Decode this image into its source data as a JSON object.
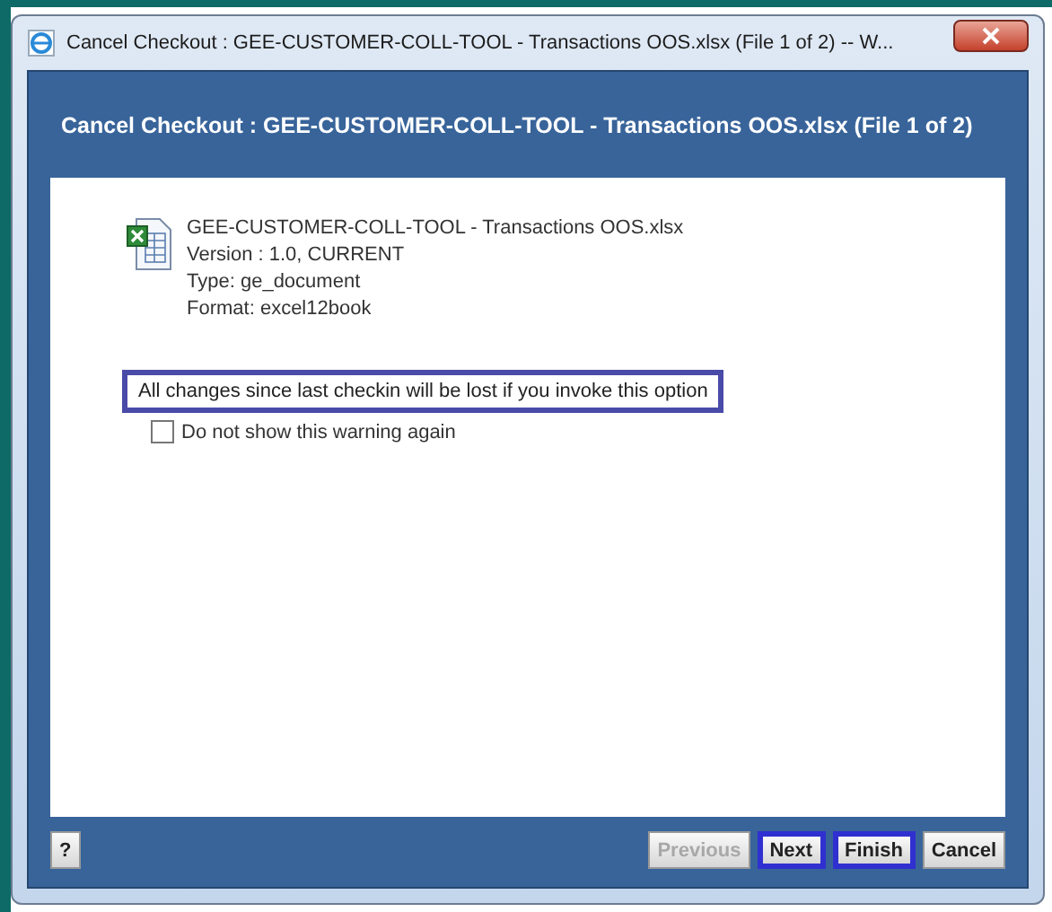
{
  "window": {
    "title": "Cancel Checkout : GEE-CUSTOMER-COLL-TOOL - Transactions OOS.xlsx (File 1 of 2) -- W..."
  },
  "dialog": {
    "heading": "Cancel Checkout : GEE-CUSTOMER-COLL-TOOL - Transactions OOS.xlsx (File 1 of 2)"
  },
  "document": {
    "lines": [
      "GEE-CUSTOMER-COLL-TOOL - Transactions OOS.xlsx",
      "Version : 1.0, CURRENT",
      "Type: ge_document",
      "Format: excel12book"
    ]
  },
  "warning": {
    "text": "All changes since last checkin will be lost if you invoke this option",
    "highlighted": true
  },
  "checkbox": {
    "label": "Do not show this warning again",
    "checked": false
  },
  "help_button": {
    "label": "?"
  },
  "buttons": [
    {
      "label": "Previous",
      "disabled": true,
      "highlighted": false
    },
    {
      "label": "Next",
      "disabled": false,
      "highlighted": true
    },
    {
      "label": "Finish",
      "disabled": false,
      "highlighted": true
    },
    {
      "label": "Cancel",
      "disabled": false,
      "highlighted": false
    }
  ]
}
